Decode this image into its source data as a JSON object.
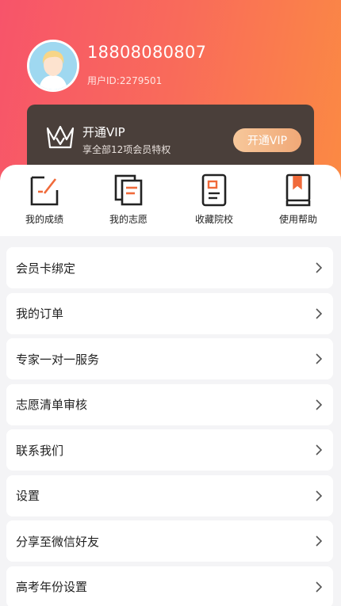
{
  "profile": {
    "phone": "18808080807",
    "user_id": "用户ID:2279501"
  },
  "vip": {
    "title": "开通VIP",
    "subtitle": "享全部12项会员特权",
    "button": "开通VIP"
  },
  "shortcuts": [
    {
      "label": "我的成绩",
      "icon": "score-edit-icon"
    },
    {
      "label": "我的志愿",
      "icon": "documents-icon"
    },
    {
      "label": "收藏院校",
      "icon": "bookmark-card-icon"
    },
    {
      "label": "使用帮助",
      "icon": "help-book-icon"
    }
  ],
  "menu": [
    "会员卡绑定",
    "我的订单",
    "专家一对一服务",
    "志愿清单审核",
    "联系我们",
    "设置",
    "分享至微信好友",
    "高考年份设置"
  ],
  "colors": {
    "accent": "#f06a3a",
    "vip_gold": "#f0a877",
    "card_dark": "#4a3f3a"
  }
}
